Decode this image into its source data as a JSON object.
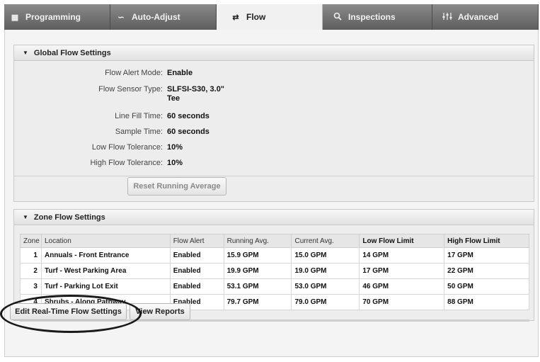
{
  "tabs": [
    {
      "label": "Programming",
      "icon": "calendar-icon",
      "glyph": "▦"
    },
    {
      "label": "Auto-Adjust",
      "icon": "wave-icon",
      "glyph": "∽"
    },
    {
      "label": "Flow",
      "icon": "flow-icon",
      "glyph": "⇄",
      "active": true
    },
    {
      "label": "Inspections",
      "icon": "magnifier-icon",
      "glyph": "🔍"
    },
    {
      "label": "Advanced",
      "icon": "sliders-icon",
      "glyph": "⫶"
    }
  ],
  "global": {
    "title": "Global Flow Settings",
    "fields": [
      {
        "label": "Flow Alert Mode:",
        "value": "Enable"
      },
      {
        "label": "Flow Sensor Type:",
        "value": "SLFSI-S30, 3.0\" Tee"
      },
      {
        "label": "Line Fill Time:",
        "value": "60 seconds"
      },
      {
        "label": "Sample Time:",
        "value": "60 seconds"
      },
      {
        "label": "Low Flow Tolerance:",
        "value": "10%"
      },
      {
        "label": "High Flow Tolerance:",
        "value": "10%"
      }
    ],
    "reset_label": "Reset Running Average"
  },
  "zone": {
    "title": "Zone Flow Settings",
    "headers": [
      "Zone",
      "Location",
      "Flow Alert",
      "Running Avg.",
      "Current Avg.",
      "Low Flow Limit",
      "High Flow Limit"
    ],
    "rows": [
      [
        "1",
        "Annuals - Front Entrance",
        "Enabled",
        "15.9 GPM",
        "15.0 GPM",
        "14 GPM",
        "17 GPM"
      ],
      [
        "2",
        "Turf - West Parking Area",
        "Enabled",
        "19.9 GPM",
        "19.0 GPM",
        "17 GPM",
        "22 GPM"
      ],
      [
        "3",
        "Turf - Parking Lot Exit",
        "Enabled",
        "53.1 GPM",
        "53.0 GPM",
        "46 GPM",
        "50 GPM"
      ],
      [
        "4",
        "Shrubs - Along Pathway",
        "Enabled",
        "79.7 GPM",
        "79.0 GPM",
        "70 GPM",
        "88 GPM"
      ]
    ]
  },
  "actions": {
    "edit_label": "Edit Real-Time Flow Settings",
    "view_label": "View Reports"
  }
}
